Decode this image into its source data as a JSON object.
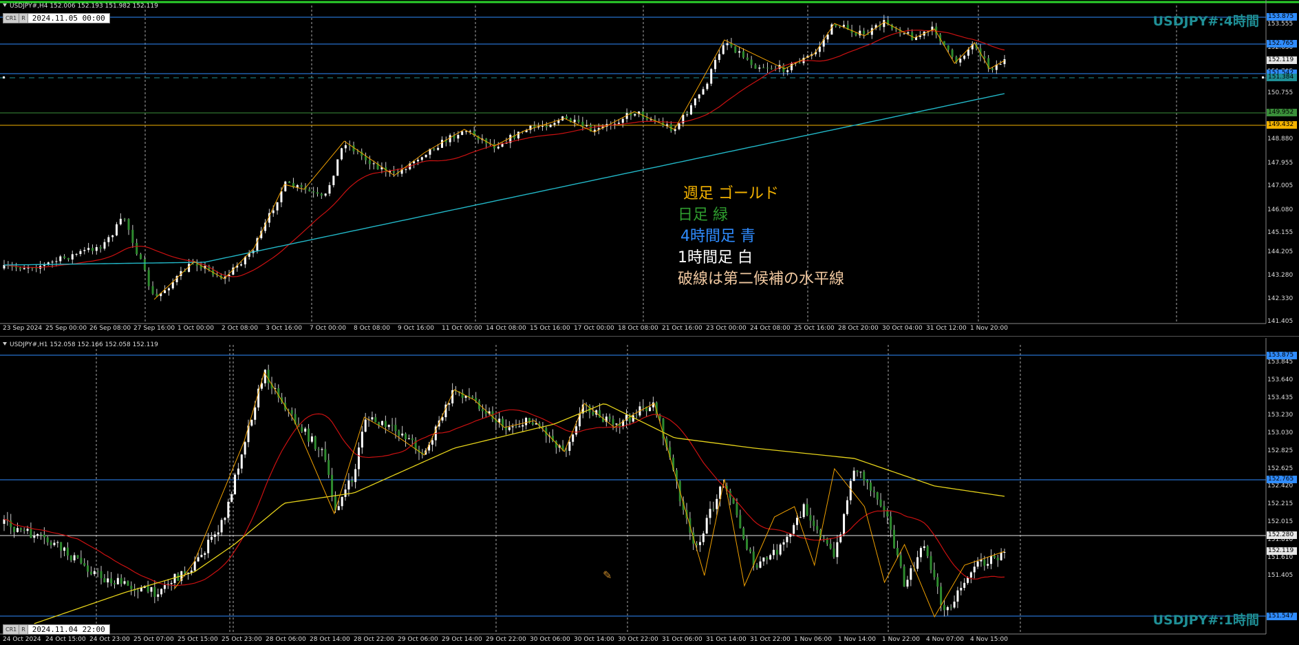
{
  "top": {
    "header": "USDJPY#,H4  152.006 152.193 151.982 152.119",
    "stamp_box": "CR1",
    "stamp_r": "R",
    "stamp_date": "2024.11.05 00:00",
    "big_title": "USDJPY#:4時間",
    "legend": [
      {
        "text": "週足  ゴールド",
        "color": "#f3b200"
      },
      {
        "text": "日足  緑",
        "color": "#2f9e2f"
      },
      {
        "text": "4時間足  青",
        "color": "#2f8cff"
      },
      {
        "text": "1時間足  白",
        "color": "#ffffff"
      },
      {
        "text": "破線は第二候補の水平線",
        "color": "#f0c8a0"
      }
    ],
    "x_labels": [
      "23 Sep 2024",
      "25 Sep 00:00",
      "26 Sep 08:00",
      "27 Sep 16:00",
      "1 Oct 00:00",
      "2 Oct 08:00",
      "3 Oct 16:00",
      "7 Oct 00:00",
      "8 Oct 08:00",
      "9 Oct 16:00",
      "11 Oct 00:00",
      "14 Oct 08:00",
      "15 Oct 16:00",
      "17 Oct 00:00",
      "18 Oct 08:00",
      "21 Oct 16:00",
      "23 Oct 00:00",
      "24 Oct 08:00",
      "25 Oct 16:00",
      "28 Oct 20:00",
      "30 Oct 04:00",
      "31 Oct 12:00",
      "1 Nov 20:00"
    ],
    "y_labels": [
      "153.555",
      "152.630",
      "151.705",
      "150.755",
      "149.830",
      "148.880",
      "147.955",
      "147.005",
      "146.080",
      "145.155",
      "144.205",
      "143.280",
      "142.330",
      "141.405"
    ],
    "tags": [
      {
        "text": "153.875",
        "bg": "#2f8cff"
      },
      {
        "text": "152.765",
        "bg": "#2f8cff"
      },
      {
        "text": "152.119",
        "bg": "#e6e6e6"
      },
      {
        "text": "151.542",
        "bg": "#2f8cff"
      },
      {
        "text": "151.384",
        "bg": "#1f8f96"
      },
      {
        "text": "149.952",
        "bg": "#3a8f3a"
      },
      {
        "text": "149.432",
        "bg": "#f3b200"
      }
    ]
  },
  "bottom": {
    "header": "USDJPY#,H1  152.058 152.166 152.058 152.119",
    "stamp_box": "CR1",
    "stamp_r": "R",
    "stamp_date": "2024.11.04 22:00",
    "big_title": "USDJPY#:1時間",
    "x_labels": [
      "24 Oct 2024",
      "24 Oct 15:00",
      "24 Oct 23:00",
      "25 Oct 07:00",
      "25 Oct 15:00",
      "25 Oct 23:00",
      "28 Oct 06:00",
      "28 Oct 14:00",
      "28 Oct 22:00",
      "29 Oct 06:00",
      "29 Oct 14:00",
      "29 Oct 22:00",
      "30 Oct 06:00",
      "30 Oct 14:00",
      "30 Oct 22:00",
      "31 Oct 06:00",
      "31 Oct 14:00",
      "31 Oct 22:00",
      "1 Nov 06:00",
      "1 Nov 14:00",
      "1 Nov 22:00",
      "4 Nov 07:00",
      "4 Nov 15:00"
    ],
    "y_labels": [
      "153.845",
      "153.640",
      "153.435",
      "153.230",
      "153.030",
      "152.825",
      "152.625",
      "152.420",
      "152.215",
      "152.015",
      "151.810",
      "151.610",
      "151.405"
    ],
    "tags": [
      {
        "text": "153.875",
        "bg": "#2f8cff"
      },
      {
        "text": "152.765",
        "bg": "#2f8cff"
      },
      {
        "text": "152.280",
        "bg": "#e6e6e6"
      },
      {
        "text": "152.119",
        "bg": "#e6e6e6"
      },
      {
        "text": "151.547",
        "bg": "#2f8cff"
      }
    ]
  },
  "colors": {
    "bull": "#ffffff",
    "bear": "#2e8b2e",
    "wick": "#cfcfcf",
    "ma_red": "#cc1111",
    "ma_cyan": "#22b8c8",
    "ma_gold": "#e6d31a",
    "zigzag": "#f0a000",
    "grid": "#aaaaaa",
    "hline_blue": "#2f8cff",
    "hline_green": "#3a8f3a",
    "hline_gold": "#f3b200",
    "hline_white": "#e6e6e6",
    "hline_teal": "#1f8f96"
  }
}
